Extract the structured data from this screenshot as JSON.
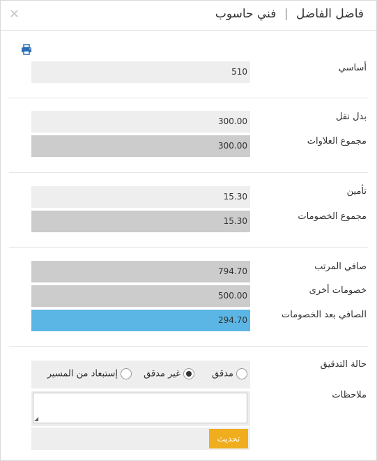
{
  "header": {
    "close_label": "×",
    "employee_name": "فاضل الفاضل",
    "separator": "|",
    "job_title": "فني حاسوب"
  },
  "toolbar": {
    "print_icon": "printer-icon"
  },
  "basic": {
    "label": "أساسي",
    "value": "510"
  },
  "allowances": {
    "transport_label": "بدل نقل",
    "transport_value": "300.00",
    "total_label": "مجموع العلاوات",
    "total_value": "300.00"
  },
  "deductions": {
    "insurance_label": "تأمين",
    "insurance_value": "15.30",
    "total_label": "مجموع الخصومات",
    "total_value": "15.30"
  },
  "net": {
    "net_label": "صافي المرتب",
    "net_value": "794.70",
    "other_label": "خصومات أخرى",
    "other_value": "500.00",
    "after_label": "الصافي بعد الخصومات",
    "after_value": "294.70"
  },
  "audit": {
    "label": "حالة التدقيق",
    "options": [
      "مدقق",
      "غير مدقق",
      "إستبعاد من المسير"
    ],
    "selected": "غير مدقق"
  },
  "notes": {
    "label": "ملاحظات",
    "value": ""
  },
  "actions": {
    "update_label": "تحديث"
  },
  "colors": {
    "accent_blue": "#5bb6e5",
    "button_orange": "#f0ad1e"
  }
}
